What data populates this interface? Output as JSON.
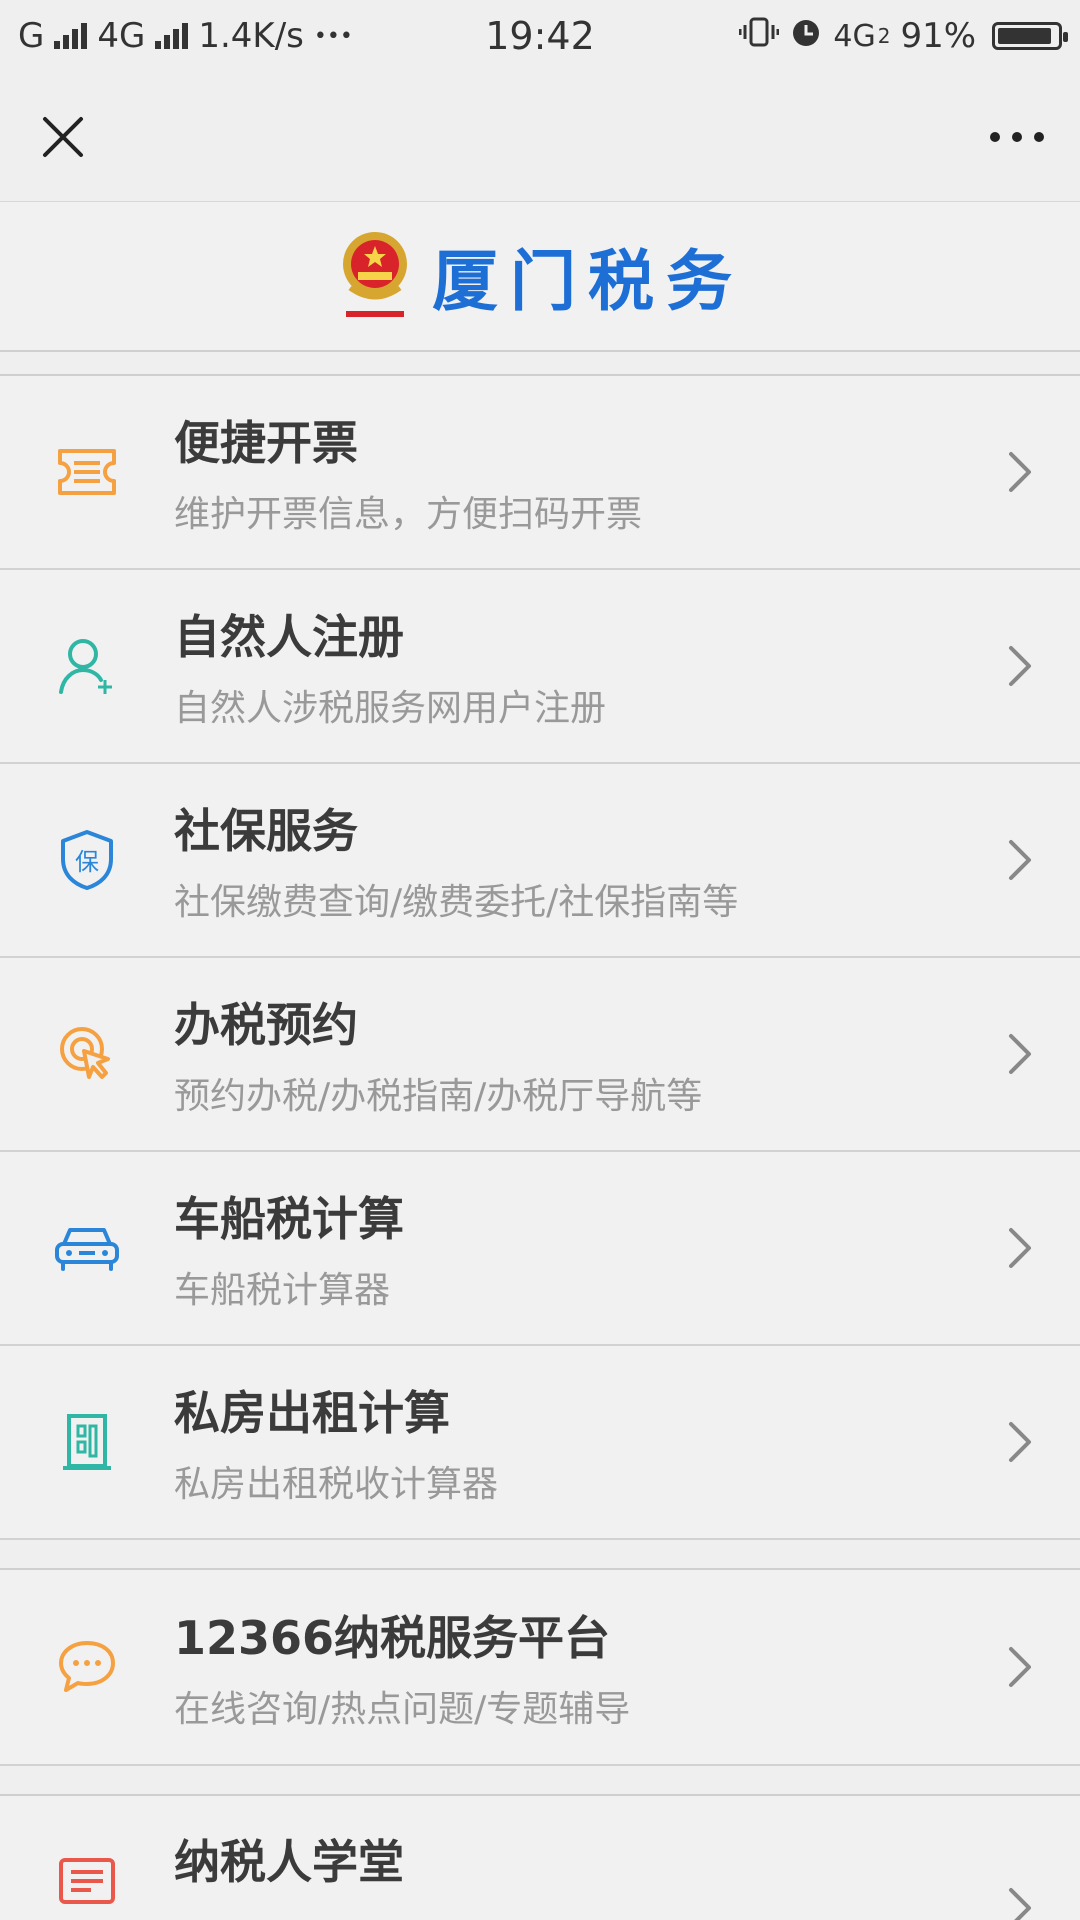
{
  "status": {
    "left": {
      "g": "G",
      "fourg": "4G",
      "speed": "1.4K/s",
      "more": "•••"
    },
    "time": "19:42",
    "right": {
      "network": "4G",
      "sub": "2",
      "battery": "91%",
      "battery_level": 0.91
    }
  },
  "nav": {
    "close_icon": "close-icon",
    "more_icon": "more-horizontal-icon"
  },
  "brand": {
    "title": "厦门税务"
  },
  "colors": {
    "brand_blue": "#1d6fd6",
    "orange": "#f5a142",
    "teal": "#2fb6a4",
    "blue": "#2b86d9",
    "red": "#e9584a"
  },
  "items_group1": [
    {
      "title": "便捷开票",
      "desc": "维护开票信息，方便扫码开票",
      "icon": "ticket-icon"
    },
    {
      "title": "自然人注册",
      "desc": "自然人涉税服务网用户注册",
      "icon": "user-add-icon"
    },
    {
      "title": "社保服务",
      "desc": "社保缴费查询/缴费委托/社保指南等",
      "icon": "shield-icon",
      "icon_text": "保"
    },
    {
      "title": "办税预约",
      "desc": "预约办税/办税指南/办税厅导航等",
      "icon": "click-icon"
    },
    {
      "title": "车船税计算",
      "desc": "车船税计算器",
      "icon": "car-icon"
    },
    {
      "title": "私房出租计算",
      "desc": "私房出租税收计算器",
      "icon": "building-icon"
    }
  ],
  "items_group2": [
    {
      "title": "12366纳税服务平台",
      "desc": "在线咨询/热点问题/专题辅导",
      "icon": "chat-icon"
    }
  ],
  "items_group3": [
    {
      "title": "纳税人学堂",
      "desc": "",
      "icon": "document-icon"
    }
  ]
}
